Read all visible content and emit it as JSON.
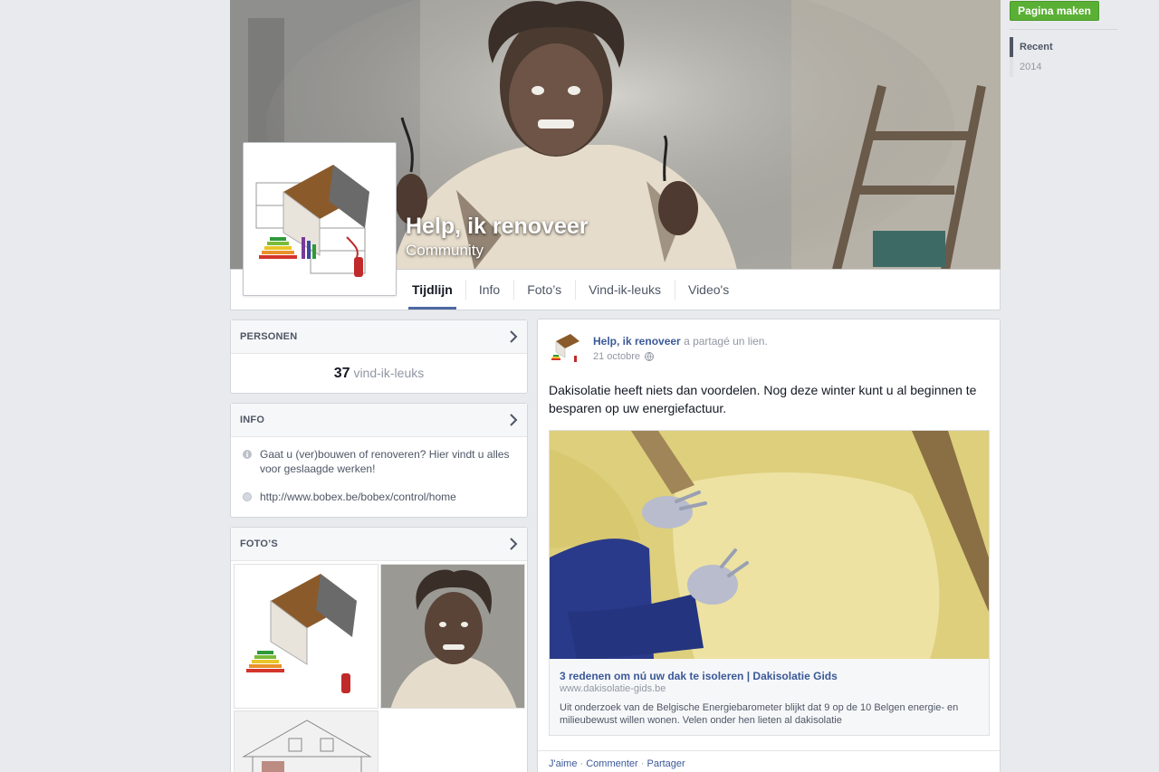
{
  "page": {
    "title": "Help, ik renoveer",
    "category": "Community"
  },
  "tabs": [
    {
      "label": "Tijdlijn",
      "active": true
    },
    {
      "label": "Info"
    },
    {
      "label": "Foto’s"
    },
    {
      "label": "Vind-ik-leuks"
    },
    {
      "label": "Video's"
    }
  ],
  "rail": {
    "create_page_label": "Pagina maken",
    "scrubber": [
      "Recent",
      "2014"
    ]
  },
  "persons": {
    "heading": "PERSONEN",
    "count": "37",
    "likes_label": "vind-ik-leuks"
  },
  "info": {
    "heading": "INFO",
    "about": "Gaat u (ver)bouwen of renoveren? Hier vindt u alles voor geslaagde werken!",
    "website": "http://www.bobex.be/bobex/control/home"
  },
  "photos": {
    "heading": "FOTO’S"
  },
  "post": {
    "author": "Help, ik renoveer",
    "action": "a partagé un lien.",
    "date": "21 octobre",
    "text": "Dakisolatie heeft niets dan voordelen. Nog deze winter kunt u al beginnen te besparen op uw energiefactuur.",
    "link": {
      "title": "3 redenen om nú uw dak te isoleren | Dakisolatie Gids",
      "domain": "www.dakisolatie-gids.be",
      "description": "Uit onderzoek van de Belgische Energiebarometer blijkt dat 9 op de 10 Belgen energie- en milieubewust willen wonen. Velen onder hen lieten al dakisolatie"
    },
    "actions": {
      "like": "J'aime",
      "comment": "Commenter",
      "share": "Partager",
      "separator": " · "
    }
  },
  "colors": {
    "link_blue": "#3b5998",
    "create_green": "#5ab034",
    "tab_underline": "#4e69a2",
    "page_bg": "#e9eaed"
  }
}
